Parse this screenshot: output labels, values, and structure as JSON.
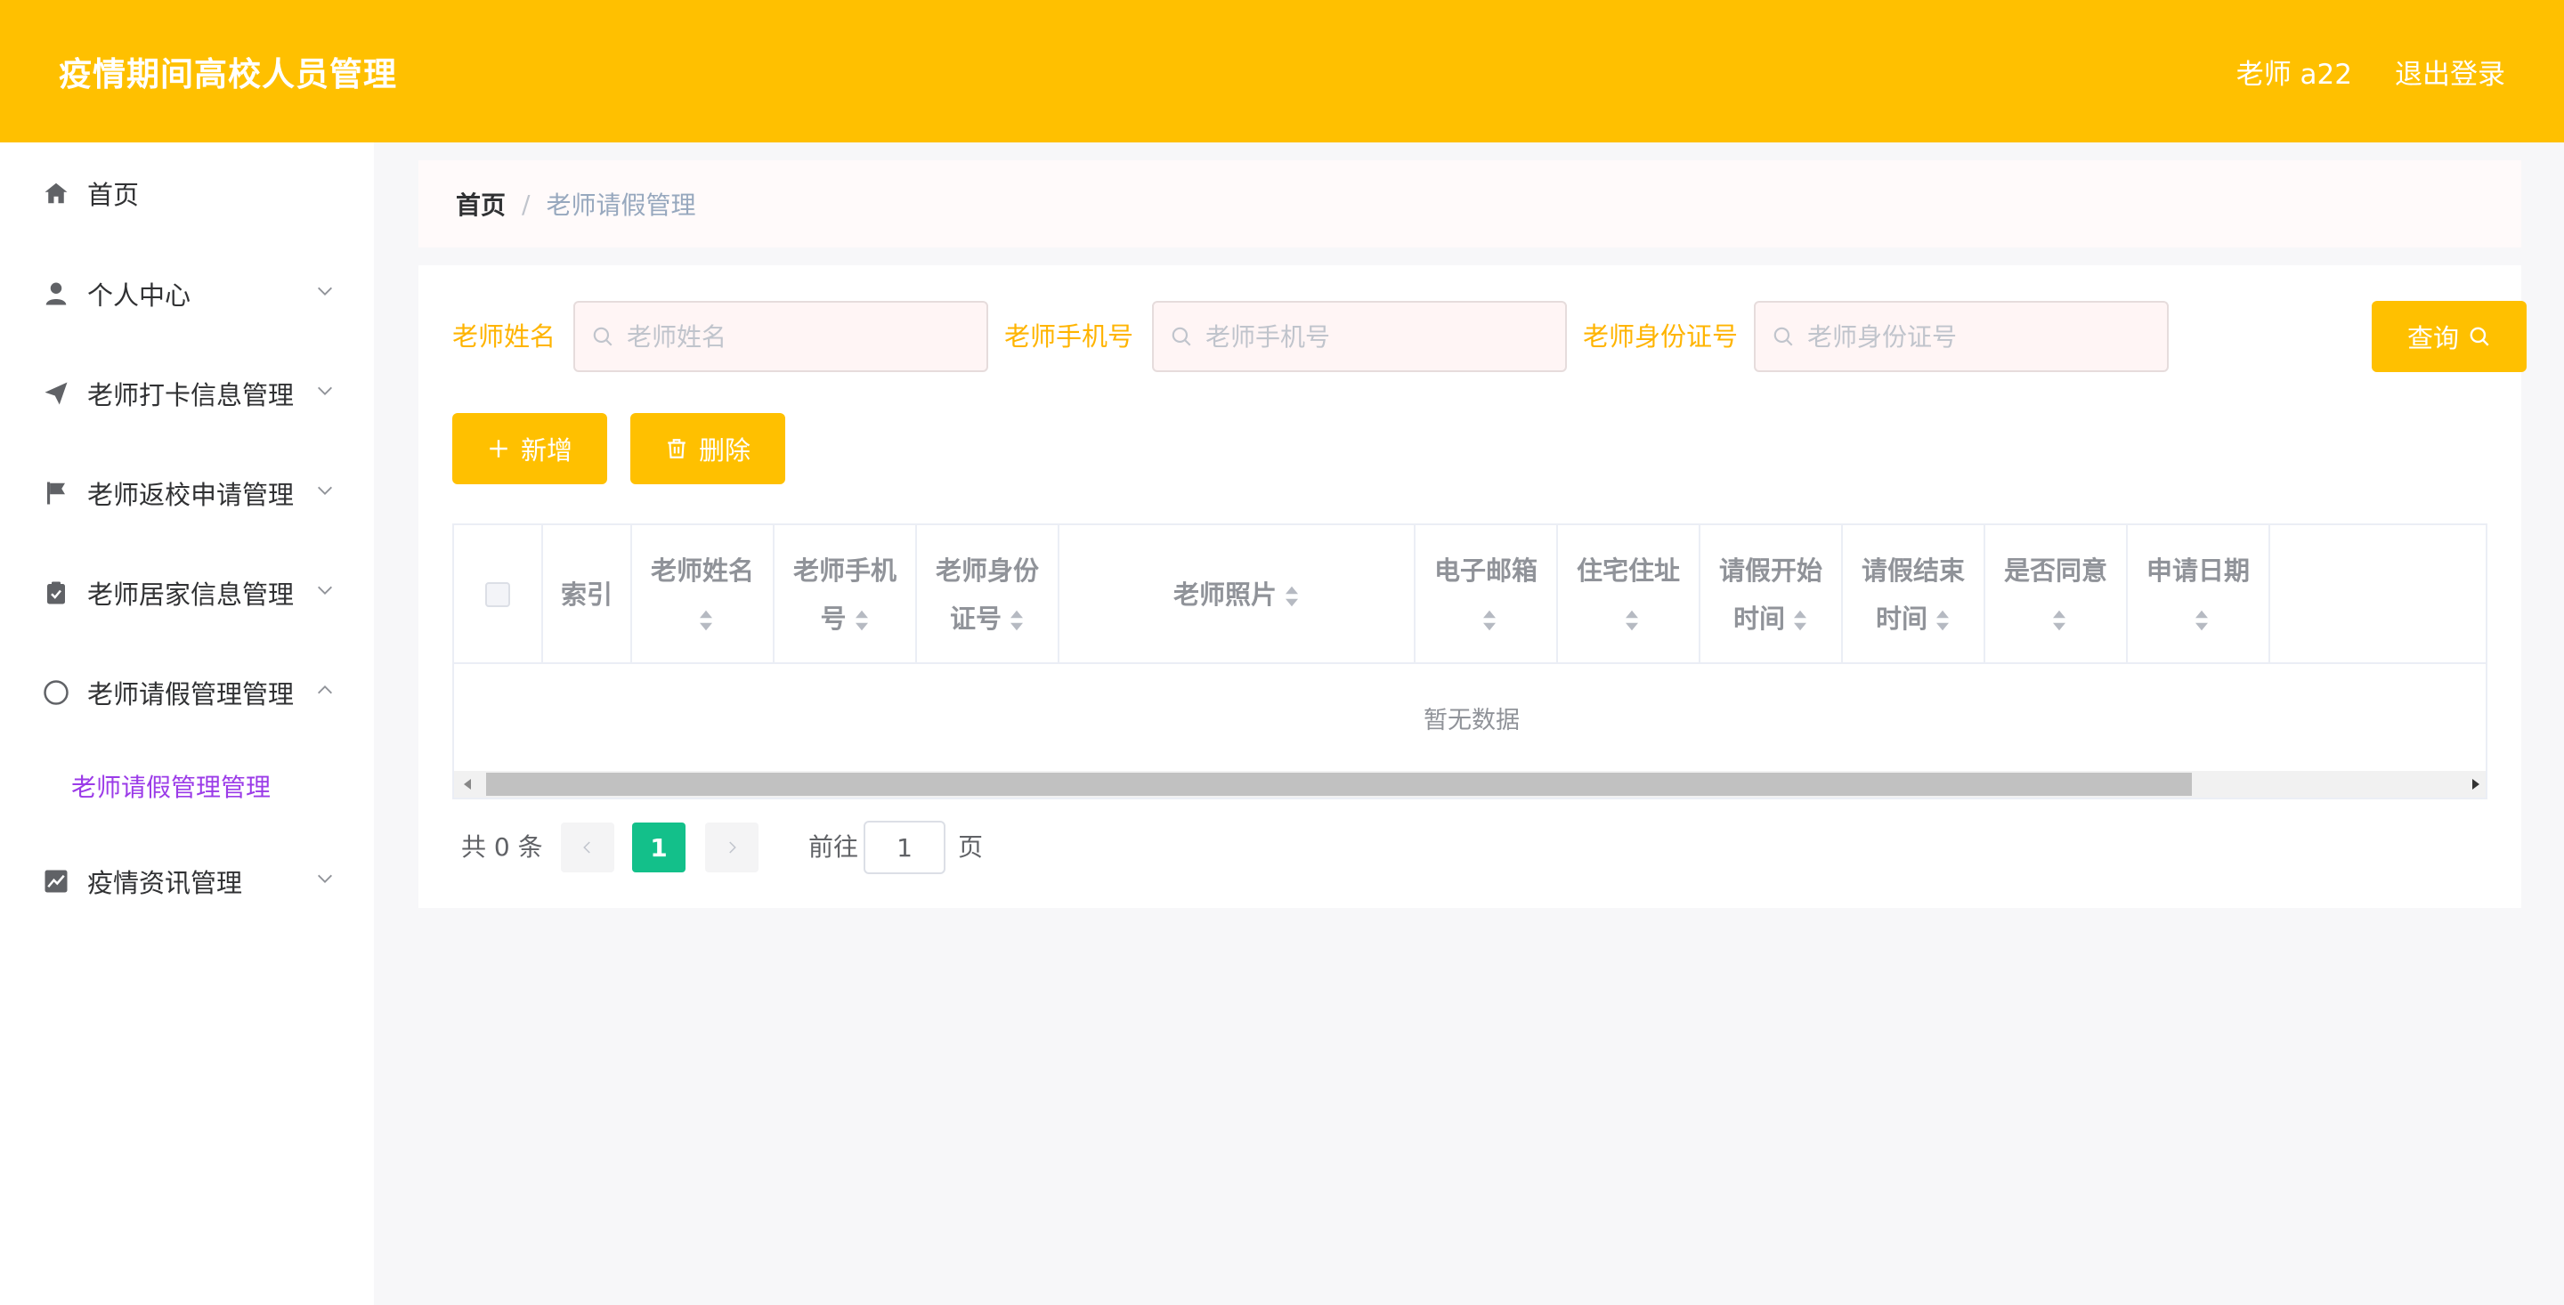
{
  "header": {
    "title": "疫情期间高校人员管理",
    "user": "老师 a22",
    "logout": "退出登录"
  },
  "sidebar": {
    "items": [
      {
        "label": "首页",
        "icon": "home-icon"
      },
      {
        "label": "个人中心",
        "icon": "user-icon"
      },
      {
        "label": "老师打卡信息管理",
        "icon": "send-icon"
      },
      {
        "label": "老师返校申请管理",
        "icon": "flag-icon"
      },
      {
        "label": "老师居家信息管理",
        "icon": "clipboard-check-icon"
      },
      {
        "label": "老师请假管理管理",
        "icon": "compass-icon"
      },
      {
        "label": "疫情资讯管理",
        "icon": "chart-icon"
      }
    ],
    "submenu": {
      "label": "老师请假管理管理"
    }
  },
  "breadcrumb": {
    "home": "首页",
    "separator": "/",
    "current": "老师请假管理"
  },
  "search": {
    "name_label": "老师姓名",
    "name_placeholder": "老师姓名",
    "phone_label": "老师手机号",
    "phone_placeholder": "老师手机号",
    "id_label": "老师身份证号",
    "id_placeholder": "老师身份证号",
    "query_button": "查询"
  },
  "actions": {
    "add": "新增",
    "delete": "删除"
  },
  "table": {
    "columns": [
      {
        "line1": "索引",
        "line2": "",
        "sortable": false
      },
      {
        "line1": "老师姓名",
        "line2": "",
        "sortable": true
      },
      {
        "line1": "老师手机",
        "line2": "号",
        "sortable": true
      },
      {
        "line1": "老师身份",
        "line2": "证号",
        "sortable": true
      },
      {
        "line1": "老师照片",
        "line2": "",
        "sortable": true
      },
      {
        "line1": "电子邮箱",
        "line2": "",
        "sortable": true
      },
      {
        "line1": "住宅住址",
        "line2": "",
        "sortable": true
      },
      {
        "line1": "请假开始",
        "line2": "时间",
        "sortable": true
      },
      {
        "line1": "请假结束",
        "line2": "时间",
        "sortable": true
      },
      {
        "line1": "是否同意",
        "line2": "",
        "sortable": true
      },
      {
        "line1": "申请日期",
        "line2": "",
        "sortable": true
      }
    ],
    "empty_text": "暂无数据"
  },
  "pagination": {
    "total": "共 0 条",
    "current_page": "1",
    "goto_label": "前往",
    "goto_value": "1",
    "page_suffix": "页"
  },
  "colors": {
    "primary": "#ffc000",
    "active_submenu": "#9b3be8",
    "current_page": "#13c08a"
  }
}
